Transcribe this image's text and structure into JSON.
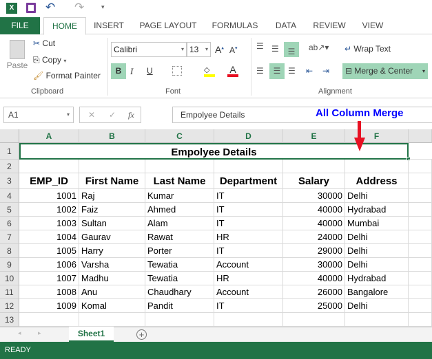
{
  "ribbon_tabs": [
    "FILE",
    "HOME",
    "INSERT",
    "PAGE LAYOUT",
    "FORMULAS",
    "DATA",
    "REVIEW",
    "VIEW"
  ],
  "clipboard": {
    "paste": "Paste",
    "cut": "Cut",
    "copy": "Copy",
    "format_painter": "Format Painter",
    "label": "Clipboard"
  },
  "font": {
    "name": "Calibri",
    "size": "13",
    "bold": "B",
    "italic": "I",
    "underline": "U",
    "label": "Font",
    "fill_color": "#ffff00",
    "font_color": "#e81123"
  },
  "alignment": {
    "wrap_text": "Wrap Text",
    "merge_center": "Merge & Center",
    "label": "Alignment"
  },
  "formula_bar": {
    "name_box": "A1",
    "fx": "fx",
    "value": "Empolyee Details"
  },
  "annotation": {
    "text": "All Column Merge",
    "color": "#0000ff",
    "arrow_color": "#e81123"
  },
  "columns": [
    "A",
    "B",
    "C",
    "D",
    "E",
    "F"
  ],
  "rows": [
    "1",
    "2",
    "3",
    "4",
    "5",
    "6",
    "7",
    "8",
    "9",
    "10",
    "11",
    "12",
    "13"
  ],
  "sheet": {
    "title": "Empolyee Details",
    "headers": [
      "EMP_ID",
      "First Name",
      "Last Name",
      "Department",
      "Salary",
      "Address"
    ],
    "data": [
      [
        "1001",
        "Raj",
        "Kumar",
        "IT",
        "30000",
        "Delhi"
      ],
      [
        "1002",
        "Faiz",
        "Ahmed",
        "IT",
        "40000",
        "Hydrabad"
      ],
      [
        "1003",
        "Sultan",
        "Alam",
        "IT",
        "40000",
        "Mumbai"
      ],
      [
        "1004",
        "Gaurav",
        "Rawat",
        "HR",
        "24000",
        "Delhi"
      ],
      [
        "1005",
        "Harry",
        "Porter",
        "IT",
        "29000",
        "Delhi"
      ],
      [
        "1006",
        "Varsha",
        "Tewatia",
        "Account",
        "30000",
        "Delhi"
      ],
      [
        "1007",
        "Madhu",
        "Tewatia",
        "HR",
        "40000",
        "Hydrabad"
      ],
      [
        "1008",
        "Anu",
        "Chaudhary",
        "Account",
        "26000",
        "Bangalore"
      ],
      [
        "1009",
        "Komal",
        "Pandit",
        "IT",
        "25000",
        "Delhi"
      ]
    ]
  },
  "sheet_tabs": [
    "Sheet1"
  ],
  "status": "READY",
  "accent": "#217346"
}
